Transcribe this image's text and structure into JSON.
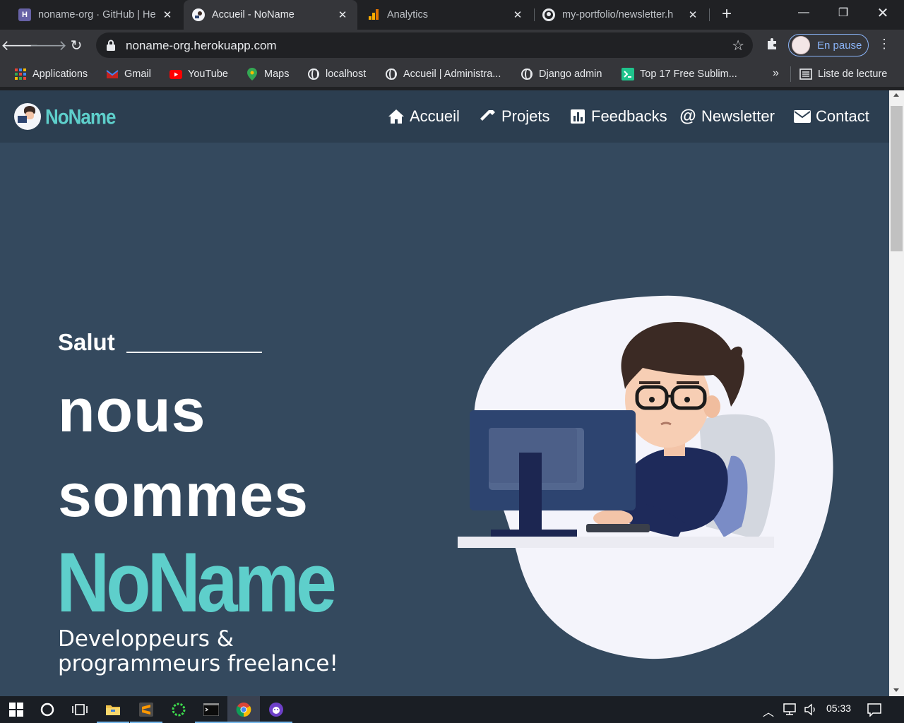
{
  "browser": {
    "tabs": [
      {
        "title": "noname-org · GitHub | He",
        "favicon": "heroku-icon",
        "active": false
      },
      {
        "title": "Accueil - NoName",
        "favicon": "noname-logo-icon",
        "active": true
      },
      {
        "title": "Analytics",
        "favicon": "analytics-icon",
        "active": false
      },
      {
        "title": "my-portfolio/newsletter.h",
        "favicon": "github-icon",
        "active": false
      }
    ],
    "url": "noname-org.herokuapp.com",
    "profile_label": "En pause",
    "bookmarks": [
      {
        "label": "Applications",
        "icon": "apps-grid-icon"
      },
      {
        "label": "Gmail",
        "icon": "gmail-icon"
      },
      {
        "label": "YouTube",
        "icon": "youtube-icon"
      },
      {
        "label": "Maps",
        "icon": "maps-pin-icon"
      },
      {
        "label": "localhost",
        "icon": "globe-icon"
      },
      {
        "label": "Accueil | Administra...",
        "icon": "globe-icon"
      },
      {
        "label": "Django admin",
        "icon": "globe-icon"
      },
      {
        "label": "Top 17 Free Sublim...",
        "icon": "terminal-icon"
      }
    ],
    "reading_list_label": "Liste de lecture"
  },
  "site": {
    "brand": "NoName",
    "nav": [
      {
        "label": "Accueil",
        "icon": "home-icon"
      },
      {
        "label": "Projets",
        "icon": "hammer-icon"
      },
      {
        "label": "Feedbacks",
        "icon": "chart-icon"
      },
      {
        "label": "Newsletter",
        "icon": "at-icon"
      },
      {
        "label": "Contact",
        "icon": "envelope-icon"
      }
    ],
    "hero": {
      "greeting": "Salut",
      "line1": "nous",
      "line2": "sommes",
      "name": "NoName",
      "subtitle": "Developpeurs & programmeurs freelance!"
    }
  },
  "taskbar": {
    "clock": "05:33"
  },
  "colors": {
    "accent": "#5ecfcb",
    "page_bg": "#34495e",
    "nav_bg": "#2c3e50"
  }
}
